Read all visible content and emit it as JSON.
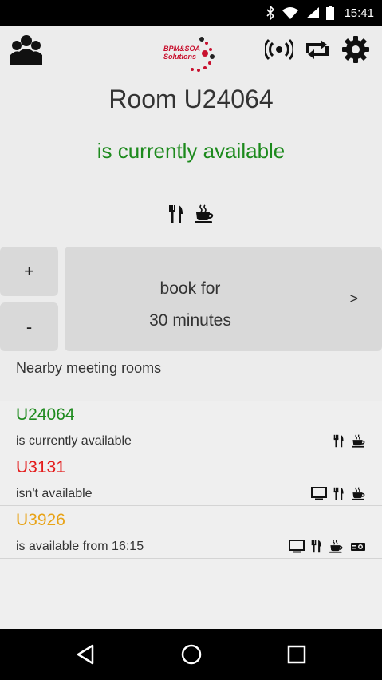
{
  "status_bar": {
    "time": "15:41",
    "icons": [
      "bluetooth-icon",
      "wifi-icon",
      "signal-icon",
      "battery-icon"
    ]
  },
  "toolbar": {
    "people_icon": "people-group-icon",
    "logo_text_line1": "BPM&SOA",
    "logo_text_line2": "Solutions",
    "actions": [
      "broadcast-icon",
      "sync-icon",
      "gear-icon"
    ]
  },
  "room": {
    "title": "Room U24064",
    "status": "is currently available",
    "status_color": "#1d8a1d",
    "amenities": [
      "fork-knife-icon",
      "coffee-cup-icon"
    ]
  },
  "booking": {
    "plus_label": "+",
    "minus_label": "-",
    "book_line1": "book for",
    "book_line2": "30 minutes",
    "arrow_label": ">"
  },
  "nearby": {
    "header": "Nearby meeting rooms",
    "rooms": [
      {
        "name": "U24064",
        "status": "is currently available",
        "color": "#1d8a1d",
        "amenities": [
          "fork-knife-icon",
          "coffee-cup-icon"
        ]
      },
      {
        "name": "U3131",
        "status": "isn't available",
        "color": "#e41b1b",
        "amenities": [
          "monitor-icon",
          "fork-knife-icon",
          "coffee-cup-icon"
        ]
      },
      {
        "name": "U3926",
        "status": "is available from 16:15",
        "color": "#e8a317",
        "amenities": [
          "monitor-icon",
          "fork-knife-icon",
          "coffee-cup-icon",
          "projector-icon"
        ]
      }
    ]
  },
  "nav": {
    "buttons": [
      "back-icon",
      "home-icon",
      "recents-icon"
    ]
  }
}
